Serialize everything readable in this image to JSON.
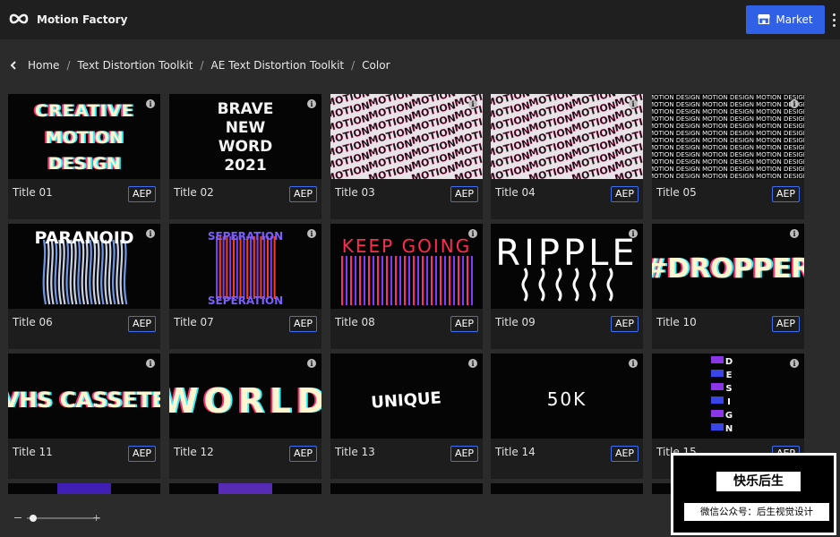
{
  "header": {
    "app_name": "Motion Factory",
    "logo_icon": "infinity-logo-icon",
    "market_label": "Market",
    "market_icon": "storefront-icon",
    "menu_icon": "vertical-dots-icon",
    "accent_color": "#2f60e6"
  },
  "breadcrumb": {
    "back_icon": "chevron-left-icon",
    "items": [
      "Home",
      "Text Distortion Toolkit",
      "AE Text Distortion Toolkit",
      "Color"
    ]
  },
  "items": [
    {
      "title": "Title 01",
      "badge": "AEP",
      "preview": "CREATIVE MOTION DESIGN"
    },
    {
      "title": "Title 02",
      "badge": "AEP",
      "preview": "BRAVE NEW WORD 2021"
    },
    {
      "title": "Title 03",
      "badge": "AEP",
      "preview": "MOTION"
    },
    {
      "title": "Title 04",
      "badge": "AEP",
      "preview": "MOTION"
    },
    {
      "title": "Title 05",
      "badge": "AEP",
      "preview": "MOTION DESIGN"
    },
    {
      "title": "Title 06",
      "badge": "AEP",
      "preview": "PARANOID"
    },
    {
      "title": "Title 07",
      "badge": "AEP",
      "preview": "SEPERATION"
    },
    {
      "title": "Title 08",
      "badge": "AEP",
      "preview": "KEEP GOING"
    },
    {
      "title": "Title 09",
      "badge": "AEP",
      "preview": "RIPPLE"
    },
    {
      "title": "Title 10",
      "badge": "AEP",
      "preview": "#DROPPER"
    },
    {
      "title": "Title 11",
      "badge": "AEP",
      "preview": "VHS CASSETE"
    },
    {
      "title": "Title 12",
      "badge": "AEP",
      "preview": "WORLD"
    },
    {
      "title": "Title 13",
      "badge": "AEP",
      "preview": "UNIQUE"
    },
    {
      "title": "Title 14",
      "badge": "AEP",
      "preview": "50K"
    },
    {
      "title": "Title 15",
      "badge": "AEP",
      "preview": "DESIGN"
    }
  ],
  "zoom": {
    "minus_icon": "minus-icon",
    "plus_icon": "plus-icon",
    "level": 0.05
  },
  "watermark": {
    "line1": "快乐后生",
    "line2": "微信公众号：后生视觉设计"
  }
}
